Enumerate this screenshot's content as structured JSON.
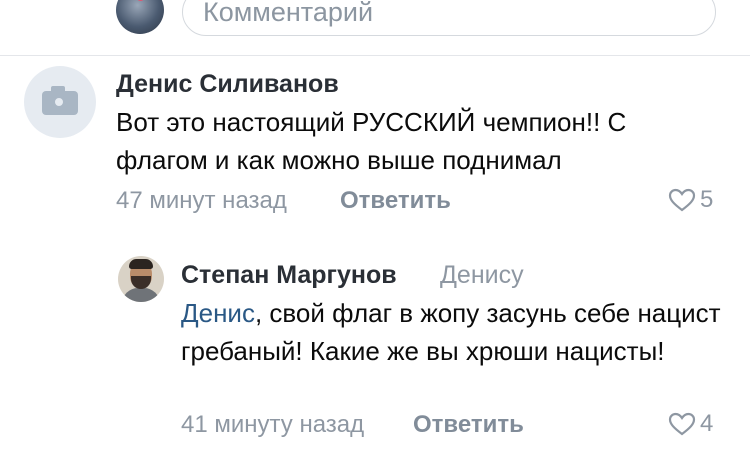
{
  "composer": {
    "placeholder": "Комментарий"
  },
  "comments": [
    {
      "author": "Денис Силиванов",
      "text": "Вот это настоящий РУССКИЙ чемпион!! С флагом и как можно выше поднимал",
      "time": "47 минут назад",
      "reply_label": "Ответить",
      "likes": "5"
    },
    {
      "author": "Степан Маргунов",
      "addressee": "Денису",
      "mention": "Денис",
      "text": ", свой флаг в жопу засунь себе нацист гребаный! Какие же вы хрюши нацисты!",
      "time": "41 минуту назад",
      "reply_label": "Ответить",
      "likes": "4"
    }
  ],
  "icons": {
    "like": "heart-outline-icon",
    "placeholder_avatar": "camera-icon"
  },
  "colors": {
    "link": "#2a5885",
    "meta": "#8e97a2",
    "author": "#2a2f36"
  }
}
